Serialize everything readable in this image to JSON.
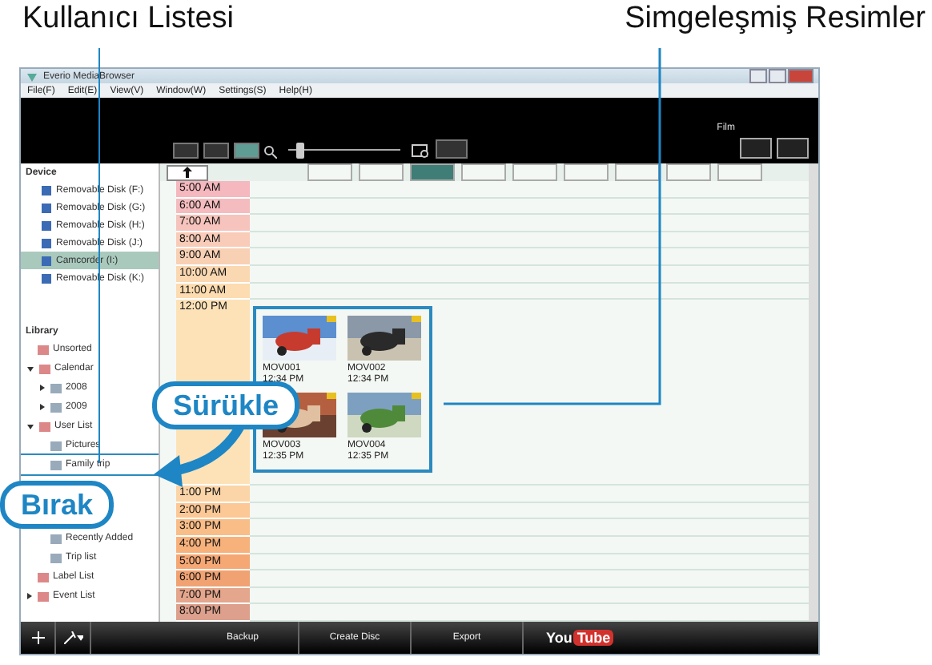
{
  "callouts": {
    "user_list": "Kullanıcı Listesi",
    "thumbnails": "Simgeleşmiş Resimler",
    "drag": "Sürükle",
    "drop": "Bırak"
  },
  "window": {
    "title": "Everio MediaBrowser"
  },
  "menu": [
    "File(F)",
    "Edit(E)",
    "View(V)",
    "Window(W)",
    "Settings(S)",
    "Help(H)"
  ],
  "toolbar": {
    "view_modes": [
      {
        "selected": false
      },
      {
        "selected": false
      },
      {
        "selected": true
      }
    ],
    "zoom": {
      "level": 0.08
    },
    "filter_label": "Film"
  },
  "view_tabs": [
    {
      "selected": false
    },
    {
      "selected": false
    },
    {
      "selected": true
    },
    {
      "selected": false
    },
    {
      "selected": false
    },
    {
      "selected": false
    },
    {
      "selected": false
    },
    {
      "selected": false
    },
    {
      "selected": false
    }
  ],
  "sidebar": {
    "device_header": "Device",
    "devices": [
      {
        "label": "Removable Disk (F:)",
        "selected": false
      },
      {
        "label": "Removable Disk (G:)",
        "selected": false
      },
      {
        "label": "Removable Disk (H:)",
        "selected": false
      },
      {
        "label": "Removable Disk (J:)",
        "selected": false
      },
      {
        "label": "Camcorder (I:)",
        "selected": true
      },
      {
        "label": "Removable Disk (K:)",
        "selected": false
      }
    ],
    "library_header": "Library",
    "library": [
      {
        "label": "Unsorted"
      },
      {
        "label": "Calendar",
        "expanded": true,
        "children": [
          {
            "label": "2008",
            "expanded": false
          },
          {
            "label": "2009",
            "expanded": false
          }
        ]
      },
      {
        "label": "User List",
        "expanded": true,
        "children": [
          {
            "label": "Pictures"
          },
          {
            "label": "Family trip",
            "drop_target": true
          },
          {
            "label": "Recently Added"
          },
          {
            "label": "Trip list"
          }
        ]
      },
      {
        "label": "Label List"
      },
      {
        "label": "Event List",
        "expanded": false
      }
    ]
  },
  "timeline": {
    "am": [
      "5:00 AM",
      "6:00 AM",
      "7:00 AM",
      "8:00 AM",
      "9:00 AM",
      "10:00 AM",
      "11:00 AM",
      "12:00 PM"
    ],
    "pm": [
      "1:00 PM",
      "2:00 PM",
      "3:00 PM",
      "4:00 PM",
      "5:00 PM",
      "6:00 PM",
      "7:00 PM",
      "8:00 PM"
    ],
    "thumbnails": [
      {
        "name": "MOV001",
        "time": "12:34 PM"
      },
      {
        "name": "MOV002",
        "time": "12:34 PM"
      },
      {
        "name": "MOV003",
        "time": "12:35 PM"
      },
      {
        "name": "MOV004",
        "time": "12:35 PM"
      }
    ]
  },
  "bottom_bar": {
    "buttons": [
      "Backup",
      "Create Disc",
      "Export"
    ],
    "youtube": {
      "you": "You",
      "tube": "Tube"
    }
  }
}
